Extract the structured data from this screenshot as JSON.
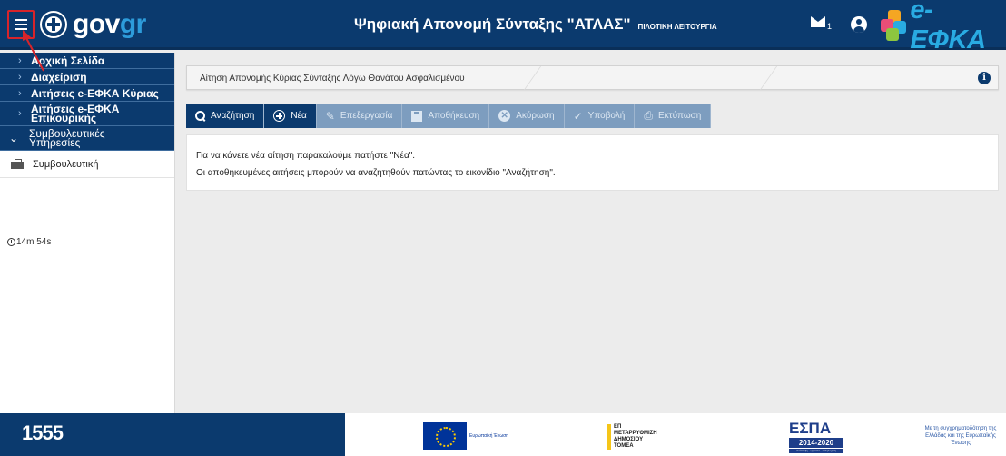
{
  "header": {
    "logo_text_gov": "gov",
    "logo_text_gr": "gr",
    "title": "Ψηφιακή Απονομή Σύνταξης \"ΑΤΛΑΣ\"",
    "subtitle": "ΠΙΛΟΤΙΚΗ ΛΕΙΤΟΥΡΓΙΑ",
    "mail_count": "1",
    "efka_text": "e-ΕΦΚΑ"
  },
  "sidebar": {
    "items": [
      {
        "label": "Αρχική Σελίδα"
      },
      {
        "label": "Διαχείριση"
      },
      {
        "label": "Αιτήσεις e-ΕΦΚΑ Κύριας"
      },
      {
        "label": "Αιτήσεις e-ΕΦΚΑ Επικουρικής"
      },
      {
        "label": "Συμβουλευτικές Υπηρεσίες"
      }
    ],
    "sub_item": "Συμβουλευτική",
    "timer": "14m 54s"
  },
  "panel": {
    "title": "Αίτηση Απονομής Κύριας Σύνταξης  Λόγω Θανάτου Ασφαλισμένου"
  },
  "toolbar": {
    "search": "Αναζήτηση",
    "new": "Νέα",
    "edit": "Επεξεργασία",
    "save": "Αποθήκευση",
    "cancel": "Ακύρωση",
    "submit": "Υποβολή",
    "print": "Εκτύπωση"
  },
  "content": {
    "line1": "Για να κάνετε νέα αίτηση παρακαλούμε πατήστε \"Νέα\".",
    "line2": "Οι αποθηκευμένες αιτήσεις μπορούν να αναζητηθούν πατώντας το εικονίδιο \"Αναζήτηση\"."
  },
  "footer": {
    "phone": "1555",
    "eu_label": "Ευρωπαϊκή Ένωση",
    "metarrythmisi": "ΕΠ ΜΕΤΑΡΡΥΘΜΙΣΗ ΔΗΜΟΣΙΟΥ ΤΟΜΕΑ",
    "espa": "ΕΣΠΑ",
    "espa_years": "2014-2020",
    "espa_motto": "ανάπτυξη - εργασία - αλληλεγγύη",
    "cofund": "Με τη συγχρηματοδότηση της Ελλάδας και της Ευρωπαϊκής Ένωσης"
  },
  "colors": {
    "primary": "#0b3a6e",
    "disabled": "#7d9dbf",
    "annotation": "#d8242a",
    "accent": "#29abe2"
  }
}
